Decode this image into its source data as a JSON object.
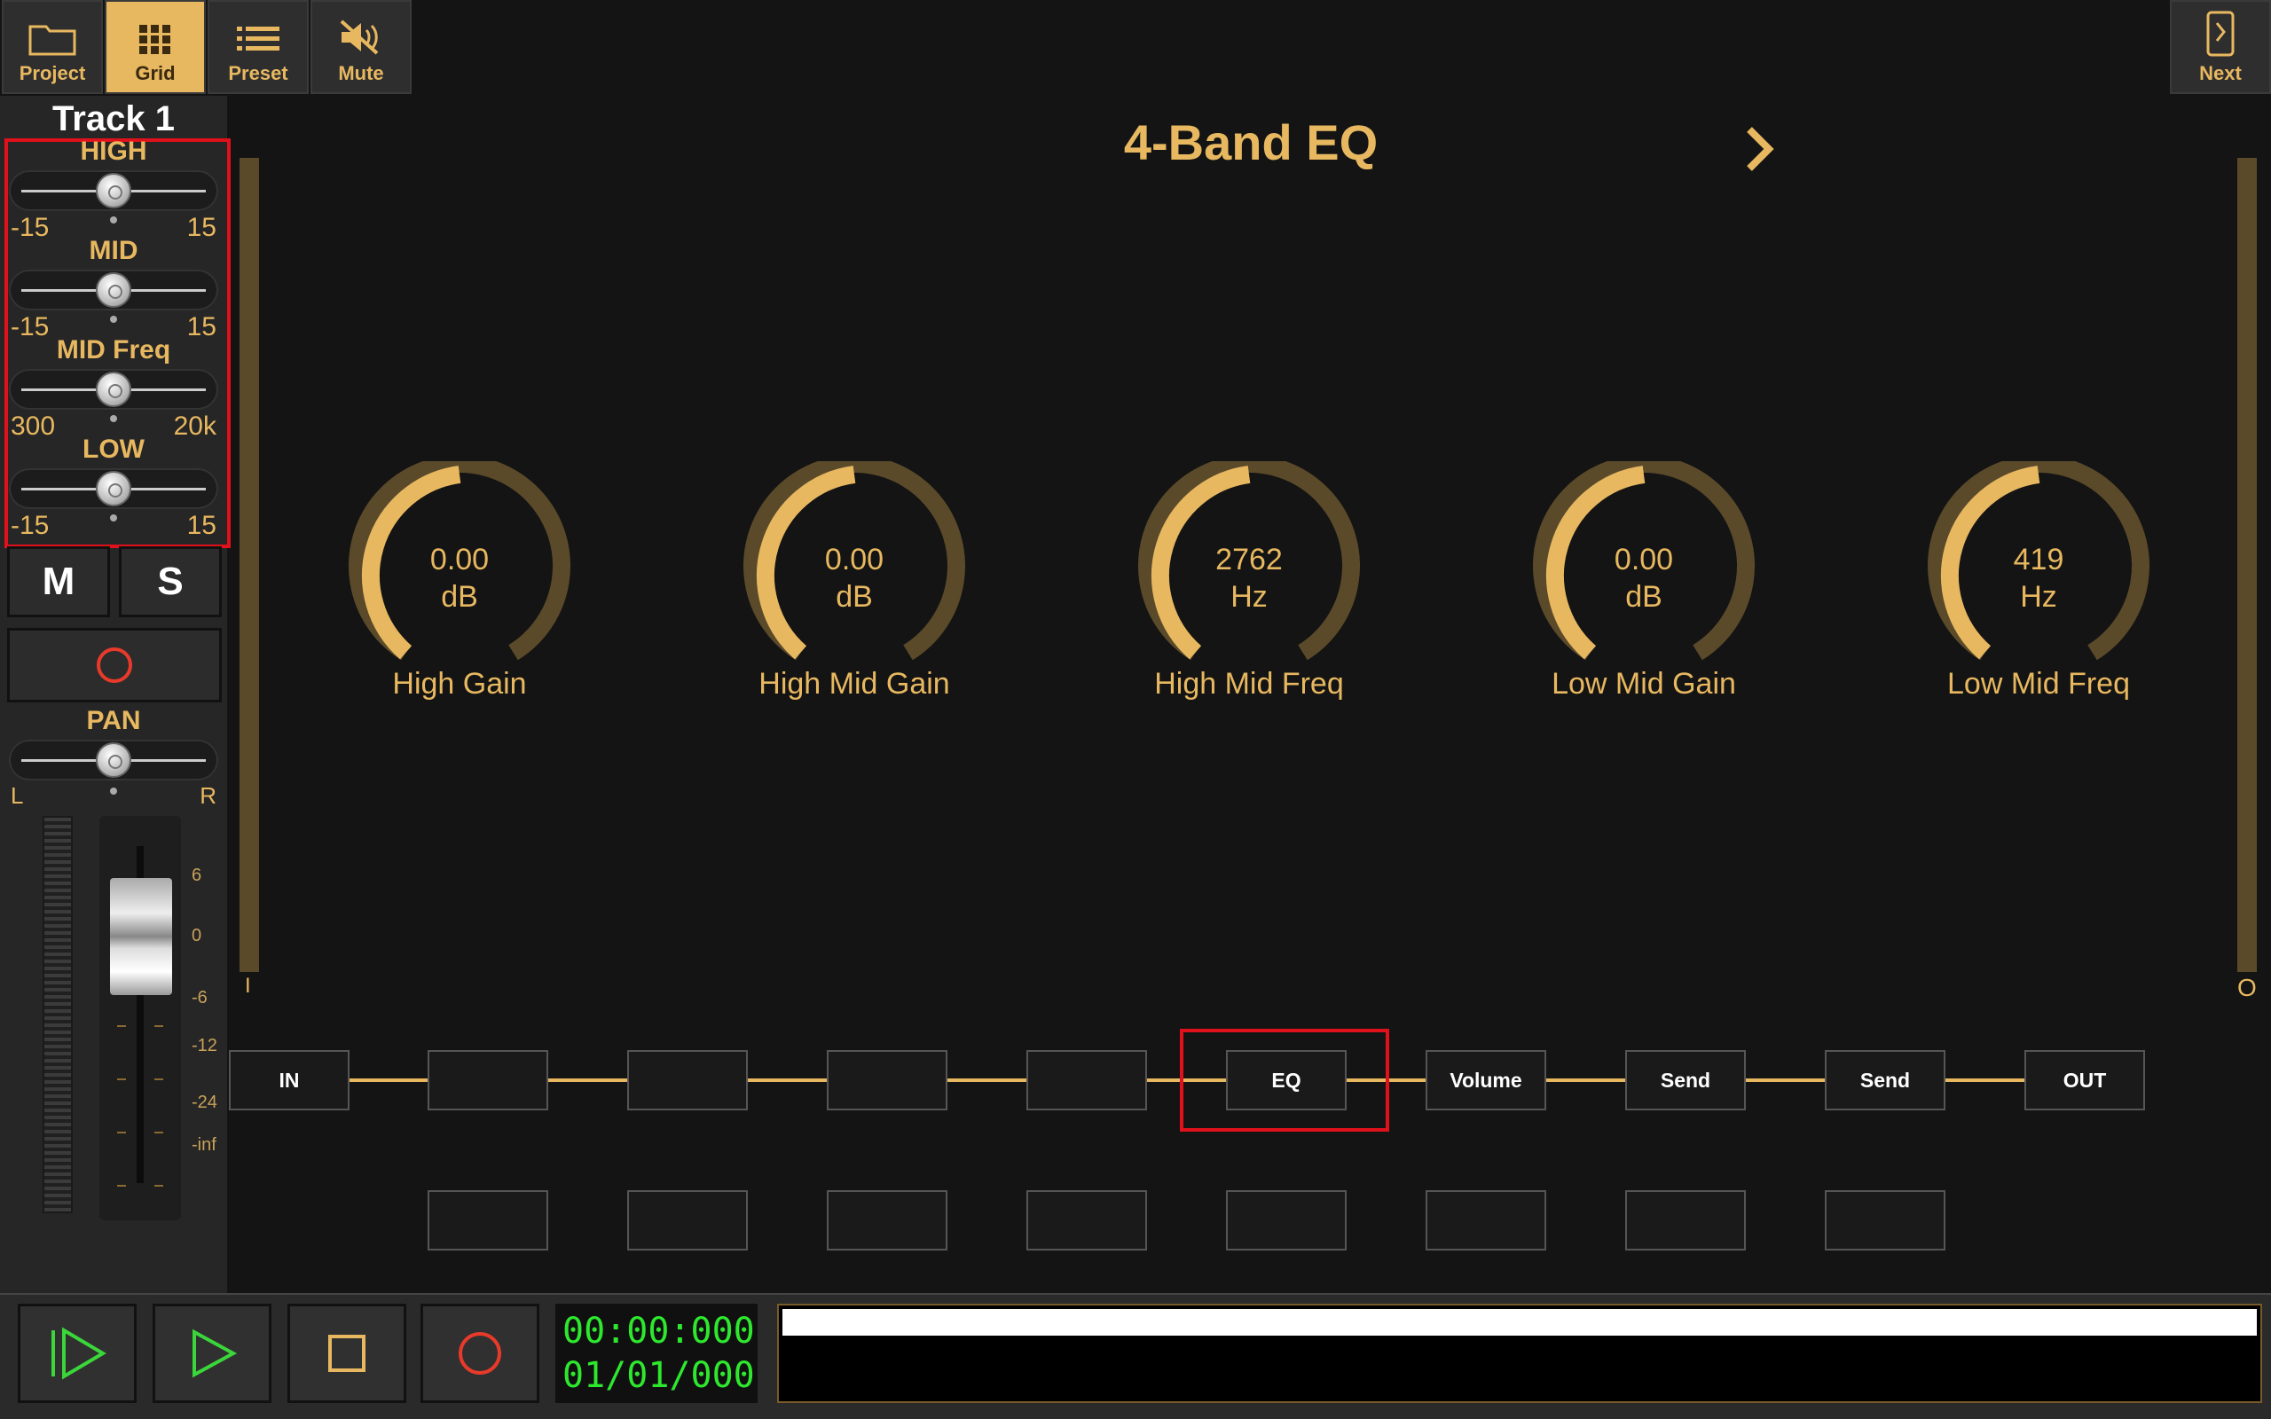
{
  "toolbar": {
    "buttons": [
      {
        "label": "Project",
        "icon": "folder-icon"
      },
      {
        "label": "Grid",
        "icon": "grid-icon",
        "active": true
      },
      {
        "label": "Preset",
        "icon": "list-icon"
      },
      {
        "label": "Mute",
        "icon": "speaker-mute-icon"
      }
    ],
    "next_label": "Next"
  },
  "sidebar": {
    "track_title": "Track 1",
    "sliders": [
      {
        "label": "HIGH",
        "min": "-15",
        "max": "15",
        "position": 0.5
      },
      {
        "label": "MID",
        "min": "-15",
        "max": "15",
        "position": 0.5
      },
      {
        "label": "MID Freq",
        "min": "300",
        "max": "20k",
        "position": 0.5
      },
      {
        "label": "LOW",
        "min": "-15",
        "max": "15",
        "position": 0.5
      }
    ],
    "mute_label": "M",
    "solo_label": "S",
    "pan": {
      "label": "PAN",
      "left": "L",
      "right": "R",
      "position": 0.5
    },
    "fader_scale": [
      "6",
      "0",
      "-6",
      "-12",
      "-24",
      "-inf"
    ]
  },
  "main": {
    "title": "4-Band EQ",
    "in_meter_label": "I",
    "out_meter_label": "O",
    "knobs": [
      {
        "value": "0.00",
        "unit": "dB",
        "name": "High Gain"
      },
      {
        "value": "0.00",
        "unit": "dB",
        "name": "High Mid Gain"
      },
      {
        "value": "2762",
        "unit": "Hz",
        "name": "High Mid Freq"
      },
      {
        "value": "0.00",
        "unit": "dB",
        "name": "Low Mid Gain"
      },
      {
        "value": "419",
        "unit": "Hz",
        "name": "Low Mid Freq"
      }
    ],
    "chain": [
      "IN",
      "",
      "",
      "",
      "",
      "EQ",
      "Volume",
      "Send",
      "Send",
      "OUT"
    ]
  },
  "transport": {
    "time": "00:00:000",
    "position": "01/01/000"
  },
  "colors": {
    "accent": "#e8b860",
    "knob_track": "#5a4a2a",
    "highlight": "#e0111a",
    "counter": "#2ee82e",
    "play": "#3ad63a",
    "stop": "#e8b860",
    "record": "#e83a2a"
  }
}
